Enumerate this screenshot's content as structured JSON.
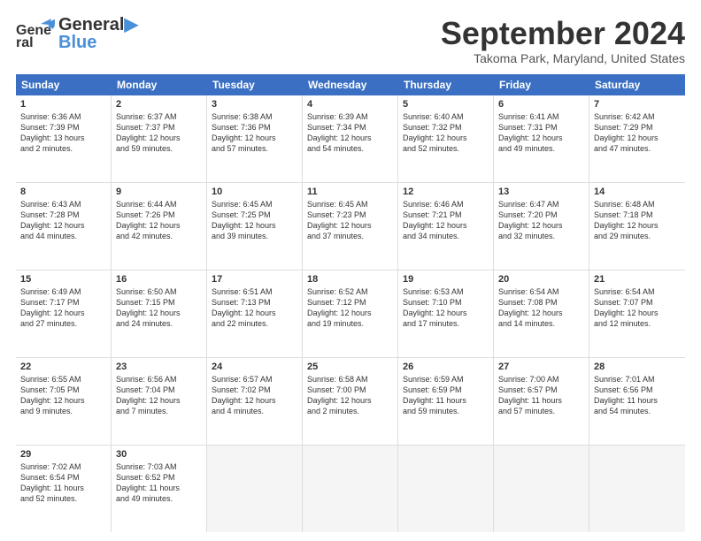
{
  "logo": {
    "text1": "General",
    "text2": "Blue"
  },
  "title": "September 2024",
  "location": "Takoma Park, Maryland, United States",
  "header_days": [
    "Sunday",
    "Monday",
    "Tuesday",
    "Wednesday",
    "Thursday",
    "Friday",
    "Saturday"
  ],
  "rows": [
    [
      {
        "day": "1",
        "lines": [
          "Sunrise: 6:36 AM",
          "Sunset: 7:39 PM",
          "Daylight: 13 hours",
          "and 2 minutes."
        ]
      },
      {
        "day": "2",
        "lines": [
          "Sunrise: 6:37 AM",
          "Sunset: 7:37 PM",
          "Daylight: 12 hours",
          "and 59 minutes."
        ]
      },
      {
        "day": "3",
        "lines": [
          "Sunrise: 6:38 AM",
          "Sunset: 7:36 PM",
          "Daylight: 12 hours",
          "and 57 minutes."
        ]
      },
      {
        "day": "4",
        "lines": [
          "Sunrise: 6:39 AM",
          "Sunset: 7:34 PM",
          "Daylight: 12 hours",
          "and 54 minutes."
        ]
      },
      {
        "day": "5",
        "lines": [
          "Sunrise: 6:40 AM",
          "Sunset: 7:32 PM",
          "Daylight: 12 hours",
          "and 52 minutes."
        ]
      },
      {
        "day": "6",
        "lines": [
          "Sunrise: 6:41 AM",
          "Sunset: 7:31 PM",
          "Daylight: 12 hours",
          "and 49 minutes."
        ]
      },
      {
        "day": "7",
        "lines": [
          "Sunrise: 6:42 AM",
          "Sunset: 7:29 PM",
          "Daylight: 12 hours",
          "and 47 minutes."
        ]
      }
    ],
    [
      {
        "day": "8",
        "lines": [
          "Sunrise: 6:43 AM",
          "Sunset: 7:28 PM",
          "Daylight: 12 hours",
          "and 44 minutes."
        ]
      },
      {
        "day": "9",
        "lines": [
          "Sunrise: 6:44 AM",
          "Sunset: 7:26 PM",
          "Daylight: 12 hours",
          "and 42 minutes."
        ]
      },
      {
        "day": "10",
        "lines": [
          "Sunrise: 6:45 AM",
          "Sunset: 7:25 PM",
          "Daylight: 12 hours",
          "and 39 minutes."
        ]
      },
      {
        "day": "11",
        "lines": [
          "Sunrise: 6:45 AM",
          "Sunset: 7:23 PM",
          "Daylight: 12 hours",
          "and 37 minutes."
        ]
      },
      {
        "day": "12",
        "lines": [
          "Sunrise: 6:46 AM",
          "Sunset: 7:21 PM",
          "Daylight: 12 hours",
          "and 34 minutes."
        ]
      },
      {
        "day": "13",
        "lines": [
          "Sunrise: 6:47 AM",
          "Sunset: 7:20 PM",
          "Daylight: 12 hours",
          "and 32 minutes."
        ]
      },
      {
        "day": "14",
        "lines": [
          "Sunrise: 6:48 AM",
          "Sunset: 7:18 PM",
          "Daylight: 12 hours",
          "and 29 minutes."
        ]
      }
    ],
    [
      {
        "day": "15",
        "lines": [
          "Sunrise: 6:49 AM",
          "Sunset: 7:17 PM",
          "Daylight: 12 hours",
          "and 27 minutes."
        ]
      },
      {
        "day": "16",
        "lines": [
          "Sunrise: 6:50 AM",
          "Sunset: 7:15 PM",
          "Daylight: 12 hours",
          "and 24 minutes."
        ]
      },
      {
        "day": "17",
        "lines": [
          "Sunrise: 6:51 AM",
          "Sunset: 7:13 PM",
          "Daylight: 12 hours",
          "and 22 minutes."
        ]
      },
      {
        "day": "18",
        "lines": [
          "Sunrise: 6:52 AM",
          "Sunset: 7:12 PM",
          "Daylight: 12 hours",
          "and 19 minutes."
        ]
      },
      {
        "day": "19",
        "lines": [
          "Sunrise: 6:53 AM",
          "Sunset: 7:10 PM",
          "Daylight: 12 hours",
          "and 17 minutes."
        ]
      },
      {
        "day": "20",
        "lines": [
          "Sunrise: 6:54 AM",
          "Sunset: 7:08 PM",
          "Daylight: 12 hours",
          "and 14 minutes."
        ]
      },
      {
        "day": "21",
        "lines": [
          "Sunrise: 6:54 AM",
          "Sunset: 7:07 PM",
          "Daylight: 12 hours",
          "and 12 minutes."
        ]
      }
    ],
    [
      {
        "day": "22",
        "lines": [
          "Sunrise: 6:55 AM",
          "Sunset: 7:05 PM",
          "Daylight: 12 hours",
          "and 9 minutes."
        ]
      },
      {
        "day": "23",
        "lines": [
          "Sunrise: 6:56 AM",
          "Sunset: 7:04 PM",
          "Daylight: 12 hours",
          "and 7 minutes."
        ]
      },
      {
        "day": "24",
        "lines": [
          "Sunrise: 6:57 AM",
          "Sunset: 7:02 PM",
          "Daylight: 12 hours",
          "and 4 minutes."
        ]
      },
      {
        "day": "25",
        "lines": [
          "Sunrise: 6:58 AM",
          "Sunset: 7:00 PM",
          "Daylight: 12 hours",
          "and 2 minutes."
        ]
      },
      {
        "day": "26",
        "lines": [
          "Sunrise: 6:59 AM",
          "Sunset: 6:59 PM",
          "Daylight: 11 hours",
          "and 59 minutes."
        ]
      },
      {
        "day": "27",
        "lines": [
          "Sunrise: 7:00 AM",
          "Sunset: 6:57 PM",
          "Daylight: 11 hours",
          "and 57 minutes."
        ]
      },
      {
        "day": "28",
        "lines": [
          "Sunrise: 7:01 AM",
          "Sunset: 6:56 PM",
          "Daylight: 11 hours",
          "and 54 minutes."
        ]
      }
    ],
    [
      {
        "day": "29",
        "lines": [
          "Sunrise: 7:02 AM",
          "Sunset: 6:54 PM",
          "Daylight: 11 hours",
          "and 52 minutes."
        ]
      },
      {
        "day": "30",
        "lines": [
          "Sunrise: 7:03 AM",
          "Sunset: 6:52 PM",
          "Daylight: 11 hours",
          "and 49 minutes."
        ]
      },
      {
        "day": "",
        "lines": [],
        "empty": true
      },
      {
        "day": "",
        "lines": [],
        "empty": true
      },
      {
        "day": "",
        "lines": [],
        "empty": true
      },
      {
        "day": "",
        "lines": [],
        "empty": true
      },
      {
        "day": "",
        "lines": [],
        "empty": true
      }
    ]
  ]
}
